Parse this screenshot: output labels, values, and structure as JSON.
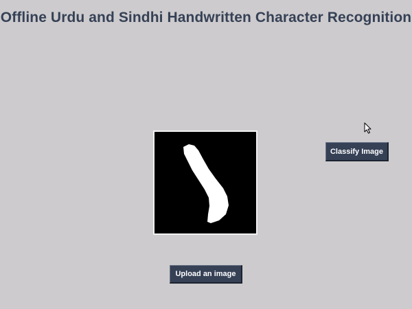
{
  "app": {
    "title": "Offline Urdu and Sindhi Handwritten Character Recognition"
  },
  "image_preview": {
    "description_icon": "handwritten-character-image",
    "background_color": "#000000",
    "stroke_color": "#ffffff"
  },
  "buttons": {
    "classify_label": "Classify Image",
    "upload_label": "Upload an image"
  },
  "colors": {
    "window_background": "#cdcbcd",
    "title_text": "#364156",
    "button_background": "#364156",
    "button_text": "#ffffff"
  },
  "cursor": {
    "icon": "arrow-cursor-icon"
  }
}
